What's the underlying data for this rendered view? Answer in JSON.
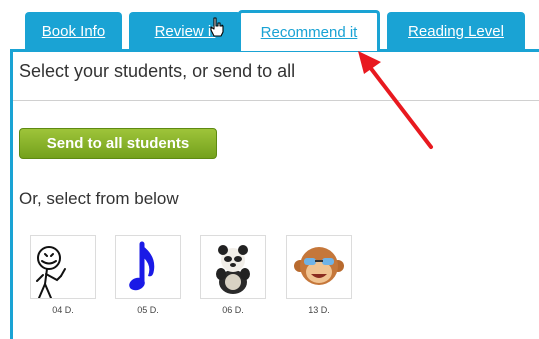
{
  "tabs": [
    {
      "label": "Book Info",
      "active": false
    },
    {
      "label": "Review it",
      "active": false
    },
    {
      "label": "Recommend it",
      "active": true
    },
    {
      "label": "Reading Level",
      "active": false
    }
  ],
  "panel": {
    "heading": "Select your students, or send to all",
    "send_all_label": "Send to all students",
    "select_text": "Or, select from below"
  },
  "students": [
    {
      "label": "04 D.",
      "avatar": "stick-figure-icon"
    },
    {
      "label": "05 D.",
      "avatar": "music-note-icon"
    },
    {
      "label": "06 D.",
      "avatar": "panda-icon"
    },
    {
      "label": "13 D.",
      "avatar": "monkey-icon"
    }
  ],
  "colors": {
    "tab": "#1aa3d4",
    "button": "#7fae24",
    "annotation_arrow": "#e8191f"
  }
}
